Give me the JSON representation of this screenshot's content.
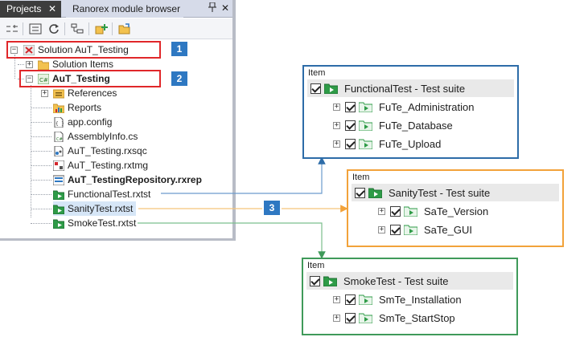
{
  "tabs": {
    "active": "Projects",
    "inactive": "Ranorex module browser",
    "close_glyph": "✕",
    "pin_glyph": "📌"
  },
  "toolbar": {
    "icons": [
      "collapse-all-icon",
      "filter-icon",
      "refresh-icon",
      "module-tree-icon",
      "add-item-icon",
      "open-folder-icon"
    ]
  },
  "tree": {
    "solution": "Solution AuT_Testing",
    "solution_items": "Solution Items",
    "project": "AuT_Testing",
    "items": [
      {
        "label": "References",
        "icon": "references-icon"
      },
      {
        "label": "Reports",
        "icon": "reports-icon"
      },
      {
        "label": "app.config",
        "icon": "config-file-icon"
      },
      {
        "label": "AssemblyInfo.cs",
        "icon": "cs-file-icon"
      },
      {
        "label": "AuT_Testing.rxsqc",
        "icon": "rxsqc-file-icon"
      },
      {
        "label": "AuT_Testing.rxtmg",
        "icon": "rxtmg-file-icon"
      },
      {
        "label": "AuT_TestingRepository.rxrep",
        "icon": "repository-icon"
      },
      {
        "label": "FunctionalTest.rxtst",
        "icon": "test-suite-icon"
      },
      {
        "label": "SanityTest.rxtst",
        "icon": "test-suite-icon"
      },
      {
        "label": "SmokeTest.rxtst",
        "icon": "test-suite-icon"
      }
    ]
  },
  "badges": [
    "1",
    "2",
    "3"
  ],
  "callouts": [
    {
      "title": "Item",
      "suite": "FunctionalTest - Test suite",
      "cases": [
        "FuTe_Administration",
        "FuTe_Database",
        "FuTe_Upload"
      ],
      "color": "#2d6ca8"
    },
    {
      "title": "Item",
      "suite": "SanityTest - Test suite",
      "cases": [
        "SaTe_Version",
        "SaTe_GUI"
      ],
      "color": "#f2a23a"
    },
    {
      "title": "Item",
      "suite": "SmokeTest - Test suite",
      "cases": [
        "SmTe_Installation",
        "SmTe_StartStop"
      ],
      "color": "#3f9a5a"
    }
  ],
  "colors": {
    "highlight_red": "#e0272a",
    "badge_blue": "#2e78c2",
    "suite_green": "#2e9b47",
    "tab_active_bg": "#3d3d3d"
  }
}
